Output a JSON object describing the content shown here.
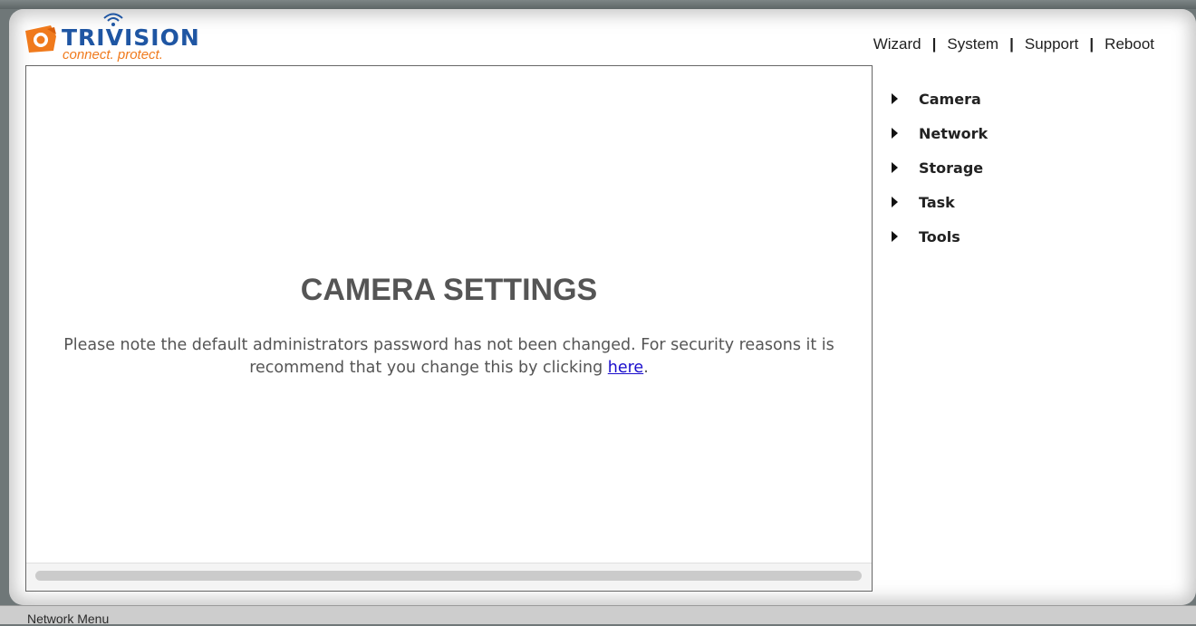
{
  "header": {
    "logo_text": "TRIVISION",
    "tagline": "connect. protect.",
    "nav": {
      "wizard": "Wizard",
      "system": "System",
      "support": "Support",
      "reboot": "Reboot",
      "separator": "|"
    }
  },
  "content": {
    "title": "CAMERA SETTINGS",
    "message_before_link": "Please note the default administrators password has not been changed. For security reasons it is recommend that you change this by clicking ",
    "link_text": "here",
    "message_after_link": "."
  },
  "side_menu": {
    "items": [
      {
        "label": "Camera"
      },
      {
        "label": "Network"
      },
      {
        "label": "Storage"
      },
      {
        "label": "Task"
      },
      {
        "label": "Tools"
      }
    ]
  },
  "status_bar": {
    "text": "Network Menu"
  },
  "colors": {
    "brand_blue": "#1f56a3",
    "brand_orange": "#f07a1c",
    "link": "#1a0dcc"
  }
}
